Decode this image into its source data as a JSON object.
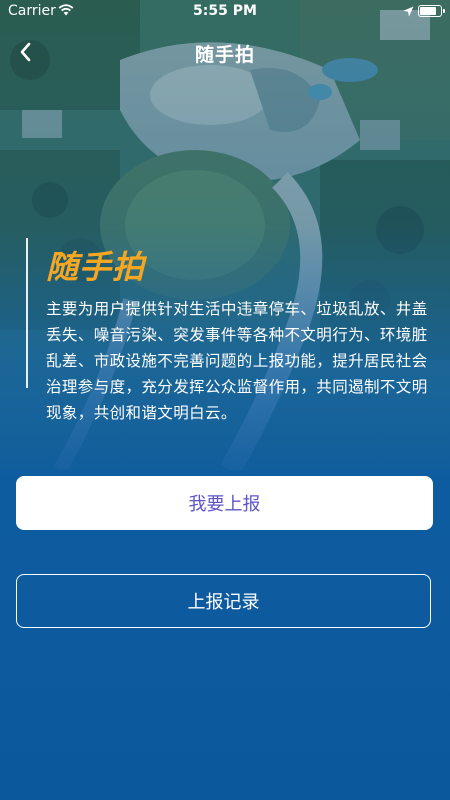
{
  "status_bar": {
    "carrier": "Carrier",
    "time": "5:55 PM",
    "battery_level": 0.9
  },
  "header": {
    "title": "随手拍",
    "back_icon": "chevron-left-icon"
  },
  "intro": {
    "title": "随手拍",
    "description": "主要为用户提供针对生活中违章停车、垃圾乱放、井盖丢失、噪音污染、突发事件等各种不文明行为、环境脏乱差、市政设施不完善问题的上报功能，提升居民社会治理参与度，充分发挥公众监督作用，共同遏制不文明现象，共创和谐文明白云。"
  },
  "actions": {
    "report_label": "我要上报",
    "records_label": "上报记录"
  },
  "colors": {
    "accent_title": "#f5a623",
    "report_text": "#5e55c9",
    "background": "#0c589c"
  }
}
